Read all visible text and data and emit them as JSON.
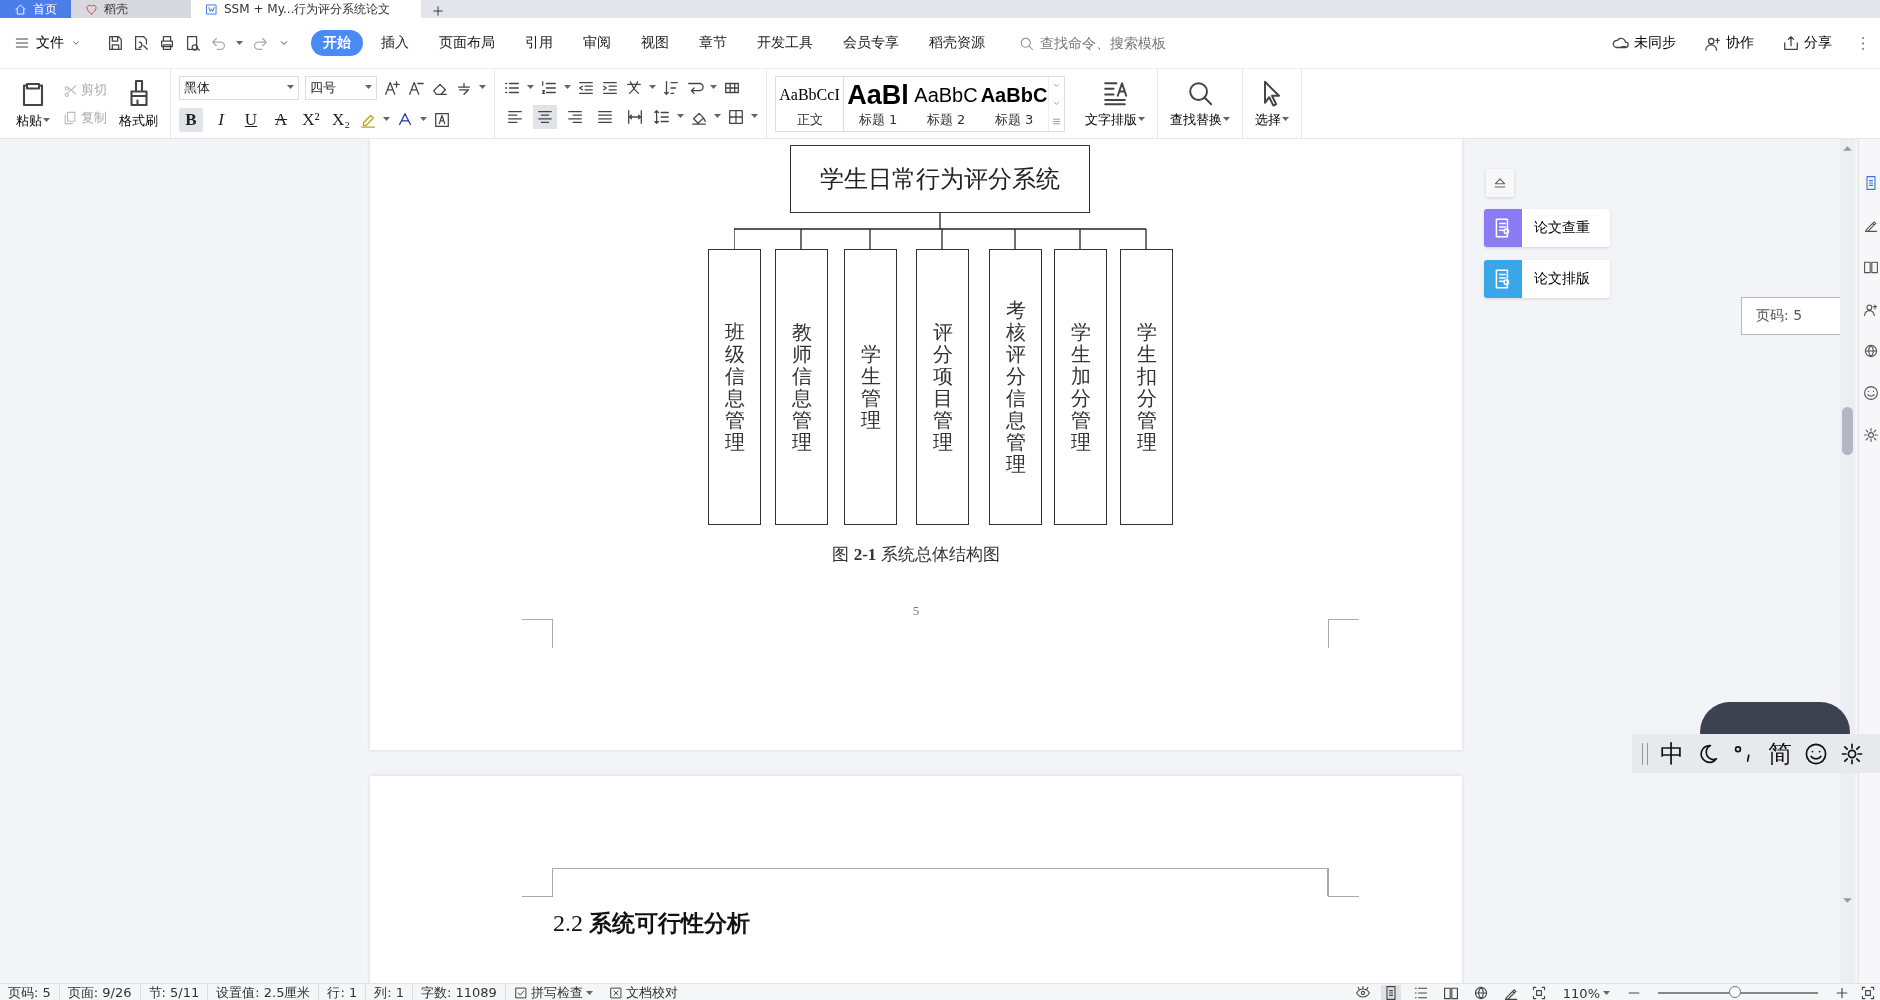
{
  "tabs": [
    {
      "label": "首页",
      "selected": false,
      "kind": "home"
    },
    {
      "label": "稻壳",
      "selected": false,
      "kind": "docer"
    },
    {
      "label": "SSM + My...行为评分系统论文",
      "selected": true,
      "kind": "doc"
    }
  ],
  "menu": {
    "file": "文件",
    "items": [
      {
        "label": "开始",
        "selected": true
      },
      {
        "label": "插入",
        "selected": false
      },
      {
        "label": "页面布局",
        "selected": false
      },
      {
        "label": "引用",
        "selected": false
      },
      {
        "label": "审阅",
        "selected": false
      },
      {
        "label": "视图",
        "selected": false
      },
      {
        "label": "章节",
        "selected": false
      },
      {
        "label": "开发工具",
        "selected": false
      },
      {
        "label": "会员专享",
        "selected": false
      },
      {
        "label": "稻壳资源",
        "selected": false
      }
    ],
    "search": {
      "placeholder": "查找命令、搜索模板"
    },
    "actions": [
      {
        "label": "未同步",
        "kind": "cloud"
      },
      {
        "label": "协作",
        "kind": "user"
      },
      {
        "label": "分享",
        "kind": "share"
      }
    ]
  },
  "ribbon": {
    "paste": "粘贴",
    "cut": {
      "label": "剪切",
      "disabled": true
    },
    "copy": {
      "label": "复制",
      "disabled": true
    },
    "format_painter": "格式刷",
    "font": {
      "family": "黑体",
      "size": "四号"
    },
    "format_buttons": [
      {
        "label": "B",
        "selected": true
      },
      {
        "label": "I",
        "selected": false
      },
      {
        "label": "U",
        "selected": false
      },
      {
        "label": "A",
        "selected": false
      },
      {
        "label": "X²",
        "selected": false
      },
      {
        "label": "X₂",
        "selected": false
      }
    ],
    "align": [
      {
        "kind": "left",
        "selected": false
      },
      {
        "kind": "center",
        "selected": true
      },
      {
        "kind": "right",
        "selected": false
      },
      {
        "kind": "justify",
        "selected": false
      },
      {
        "kind": "distributed",
        "selected": false
      }
    ],
    "styles": [
      {
        "preview": "AaBbCcI",
        "label": "正文",
        "kind": "body"
      },
      {
        "preview": "AaBl",
        "label": "标题 1",
        "kind": "h1"
      },
      {
        "preview": "AaBbC",
        "label": "标题 2",
        "kind": "h2"
      },
      {
        "preview": "AaBbC",
        "label": "标题 3",
        "kind": "h3"
      }
    ],
    "tools": [
      {
        "label": "文字排版",
        "kind": "layout"
      },
      {
        "label": "查找替换",
        "kind": "find"
      },
      {
        "label": "选择",
        "kind": "select"
      }
    ]
  },
  "document": {
    "diagram": {
      "root": "学生日常行为评分系统",
      "children": [
        "班级信息管理",
        "教师信息管理",
        "学生管理",
        "评分项目管理",
        "考核评分信息管理",
        "学生加分管理",
        "学生扣分管理"
      ]
    },
    "caption": "图 **2-1**  系统总体结构图",
    "page_number": "5",
    "heading": "2.2  **系统可行性分析**"
  },
  "side_panel": [
    {
      "label": "论文查重",
      "color": "#8b7cf6"
    },
    {
      "label": "论文排版",
      "color": "#3aa6ea"
    }
  ],
  "page_badge": "页码: 5",
  "ime": {
    "mode": "中",
    "script": "简"
  },
  "status_bar": {
    "items": [
      "页码: 5",
      "页面: 9/26",
      "节: 5/11",
      "设置值: 2.5厘米",
      "行: 1",
      "列: 1",
      "字数: 11089"
    ],
    "spell_check": "拼写检查",
    "proofread": "文档校对",
    "views": [
      {
        "kind": "page",
        "selected": true
      },
      {
        "kind": "outline",
        "selected": false
      },
      {
        "kind": "read",
        "selected": false
      },
      {
        "kind": "web",
        "selected": false
      },
      {
        "kind": "write",
        "selected": false
      }
    ],
    "zoom": "110%",
    "zoom_slider": {
      "level": 0.48
    }
  }
}
